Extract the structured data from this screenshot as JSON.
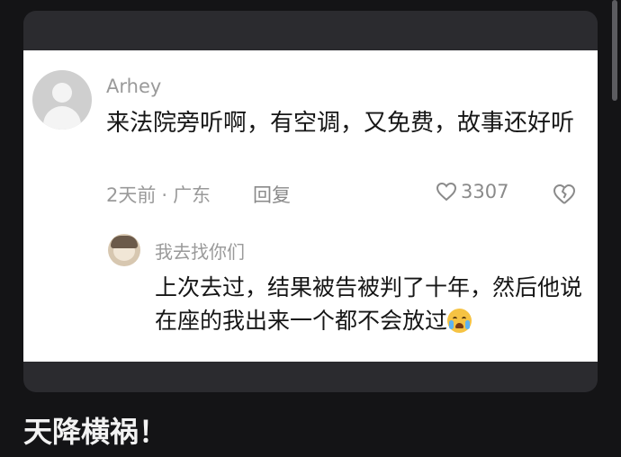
{
  "post": {
    "comment": {
      "username": "Arhey",
      "text": "来法院旁听啊，有空调，又免费，故事还好听",
      "time": "2天前",
      "separator": "·",
      "location": "广东",
      "reply_label": "回复",
      "likes": "3307"
    },
    "reply": {
      "username": "我去找你们",
      "text": "上次去过，结果被告被判了十年，然后他说在座的我出来一个都不会放过"
    }
  },
  "caption": "天降横祸！",
  "icons": {
    "like": "heart-outline-icon",
    "dislike": "broken-heart-icon",
    "emoji": "crying-face-emoji"
  },
  "colors": {
    "page_bg": "#141416",
    "card_bg": "#2b2b2f",
    "text_muted": "#9a9a9a"
  }
}
